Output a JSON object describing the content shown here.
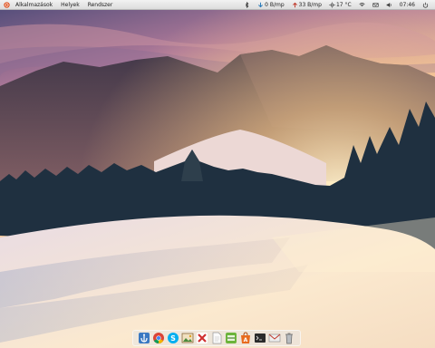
{
  "panel": {
    "menu": [
      {
        "label": "Alkalmazások"
      },
      {
        "label": "Helyek"
      },
      {
        "label": "Rendszer"
      }
    ],
    "indicators": {
      "download": "0 B/mp",
      "upload": "33 B/mp",
      "temperature": "17 °C",
      "clock": "07:46"
    }
  },
  "dock": {
    "items": [
      {
        "icon": "anchor-app-icon"
      },
      {
        "icon": "chrome-icon"
      },
      {
        "icon": "skype-icon"
      },
      {
        "icon": "image-viewer-icon"
      },
      {
        "icon": "crossover-icon"
      },
      {
        "icon": "text-document-icon"
      },
      {
        "icon": "scanner-icon"
      },
      {
        "icon": "software-center-icon"
      },
      {
        "icon": "terminal-icon"
      },
      {
        "icon": "mail-icon"
      },
      {
        "icon": "trash-icon"
      }
    ]
  },
  "colors": {
    "sky_top": "#6e5d8c",
    "sun": "#ffd89a",
    "snow": "#f3e6d6",
    "forest": "#1e2f3d"
  }
}
